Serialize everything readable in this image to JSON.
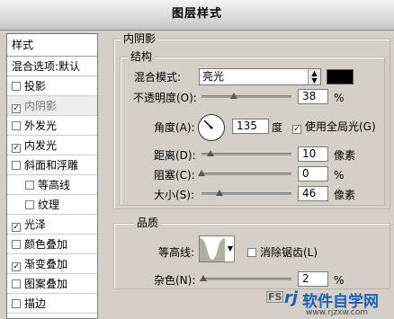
{
  "dialog": {
    "title": "图层样式"
  },
  "styles_panel": {
    "header": "样式",
    "blend_options": "混合选项:默认",
    "items": [
      {
        "label": "投影",
        "checked": false,
        "selected": false,
        "indent": false
      },
      {
        "label": "内阴影",
        "checked": true,
        "selected": true,
        "indent": false
      },
      {
        "label": "外发光",
        "checked": false,
        "selected": false,
        "indent": false
      },
      {
        "label": "内发光",
        "checked": true,
        "selected": false,
        "indent": false
      },
      {
        "label": "斜面和浮雕",
        "checked": false,
        "selected": false,
        "indent": false
      },
      {
        "label": "等高线",
        "checked": false,
        "selected": false,
        "indent": true
      },
      {
        "label": "纹理",
        "checked": false,
        "selected": false,
        "indent": true
      },
      {
        "label": "光泽",
        "checked": true,
        "selected": false,
        "indent": false
      },
      {
        "label": "颜色叠加",
        "checked": false,
        "selected": false,
        "indent": false
      },
      {
        "label": "渐变叠加",
        "checked": true,
        "selected": false,
        "indent": false
      },
      {
        "label": "图案叠加",
        "checked": false,
        "selected": false,
        "indent": false
      },
      {
        "label": "描边",
        "checked": false,
        "selected": false,
        "indent": false
      }
    ]
  },
  "inner_shadow": {
    "section_title": "内阴影",
    "structure": {
      "title": "结构",
      "blend_mode_label": "混合模式:",
      "blend_mode_value": "亮光",
      "shadow_color": "#000000",
      "opacity_label": "不透明度(O):",
      "opacity_value": "38",
      "opacity_unit": "%",
      "angle_label": "角度(A):",
      "angle_value": "135",
      "angle_unit": "度",
      "global_light_label": "使用全局光(G)",
      "global_light_checked": true,
      "distance_label": "距离(D):",
      "distance_value": "10",
      "distance_unit": "像素",
      "choke_label": "阻塞(C):",
      "choke_value": "0",
      "choke_unit": "%",
      "size_label": "大小(S):",
      "size_value": "46",
      "size_unit": "像素"
    },
    "quality": {
      "title": "品质",
      "contour_label": "等高线:",
      "antialias_label": "消除锯齿(L)",
      "antialias_checked": false,
      "noise_label": "杂色(N):",
      "noise_value": "2",
      "noise_unit": "%"
    }
  },
  "watermark": {
    "text": "软件自学网",
    "sub": "www.rjzxw.com"
  }
}
